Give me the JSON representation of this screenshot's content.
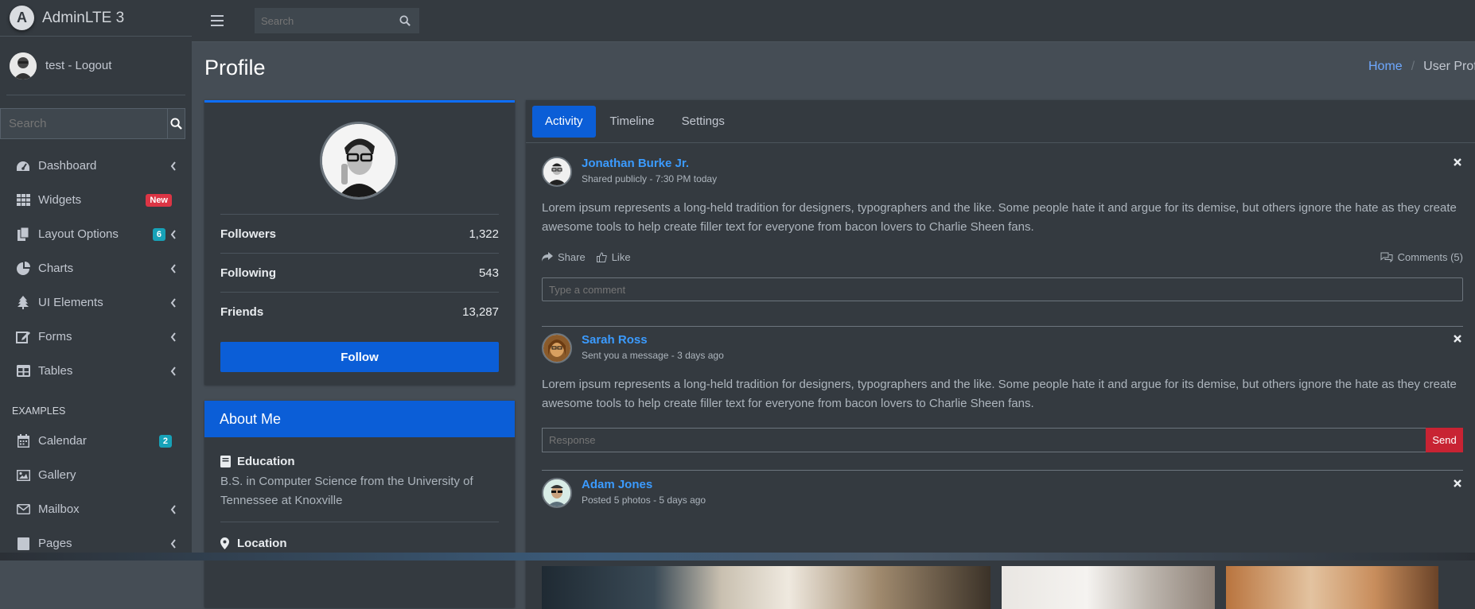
{
  "brand": {
    "name": "AdminLTE 3",
    "logo_letter": "A"
  },
  "user": {
    "label": "test - Logout"
  },
  "sidebar": {
    "search_placeholder": "Search",
    "items": [
      {
        "label": "Dashboard",
        "icon": "tachometer-icon",
        "chevron": true
      },
      {
        "label": "Widgets",
        "icon": "grid-icon",
        "badge": "New",
        "badge_color": "#dc3545"
      },
      {
        "label": "Layout Options",
        "icon": "copy-icon",
        "badge": "6",
        "badge_color": "#17a2b8",
        "chevron": true
      },
      {
        "label": "Charts",
        "icon": "pie-chart-icon",
        "chevron": true
      },
      {
        "label": "UI Elements",
        "icon": "tree-icon",
        "chevron": true
      },
      {
        "label": "Forms",
        "icon": "edit-icon",
        "chevron": true
      },
      {
        "label": "Tables",
        "icon": "table-icon",
        "chevron": true
      }
    ],
    "header": "EXAMPLES",
    "examples": [
      {
        "label": "Calendar",
        "icon": "calendar-icon",
        "badge": "2",
        "badge_color": "#17a2b8"
      },
      {
        "label": "Gallery",
        "icon": "image-icon"
      },
      {
        "label": "Mailbox",
        "icon": "envelope-icon",
        "chevron": true
      },
      {
        "label": "Pages",
        "icon": "book-icon",
        "chevron": true
      }
    ]
  },
  "topbar": {
    "search_placeholder": "Search"
  },
  "page": {
    "title": "Profile",
    "breadcrumb": {
      "home": "Home",
      "current": "User Profile"
    }
  },
  "profile": {
    "stats": [
      {
        "label": "Followers",
        "value": "1,322"
      },
      {
        "label": "Following",
        "value": "543"
      },
      {
        "label": "Friends",
        "value": "13,287"
      }
    ],
    "follow_label": "Follow"
  },
  "about": {
    "header": "About Me",
    "education_title": "Education",
    "education_text": "B.S. in Computer Science from the University of Tennessee at Knoxville",
    "location_title": "Location"
  },
  "tabs": [
    {
      "label": "Activity",
      "active": true
    },
    {
      "label": "Timeline",
      "active": false
    },
    {
      "label": "Settings",
      "active": false
    }
  ],
  "posts": [
    {
      "user": "Jonathan Burke Jr.",
      "desc": "Shared publicly - 7:30 PM today",
      "text": "Lorem ipsum represents a long-held tradition for designers, typographers and the like. Some people hate it and argue for its demise, but others ignore the hate as they create awesome tools to help create filler text for everyone from bacon lovers to Charlie Sheen fans.",
      "share": "Share",
      "like": "Like",
      "comments": "Comments (5)",
      "comment_placeholder": "Type a comment"
    },
    {
      "user": "Sarah Ross",
      "desc": "Sent you a message - 3 days ago",
      "text": "Lorem ipsum represents a long-held tradition for designers, typographers and the like. Some people hate it and argue for its demise, but others ignore the hate as they create awesome tools to help create filler text for everyone from bacon lovers to Charlie Sheen fans.",
      "response_placeholder": "Response",
      "send_label": "Send"
    },
    {
      "user": "Adam Jones",
      "desc": "Posted 5 photos - 5 days ago"
    }
  ],
  "colors": {
    "accent": "#0b5ed7",
    "link": "#3b9bff",
    "danger": "#c82333",
    "info": "#17a2b8"
  }
}
